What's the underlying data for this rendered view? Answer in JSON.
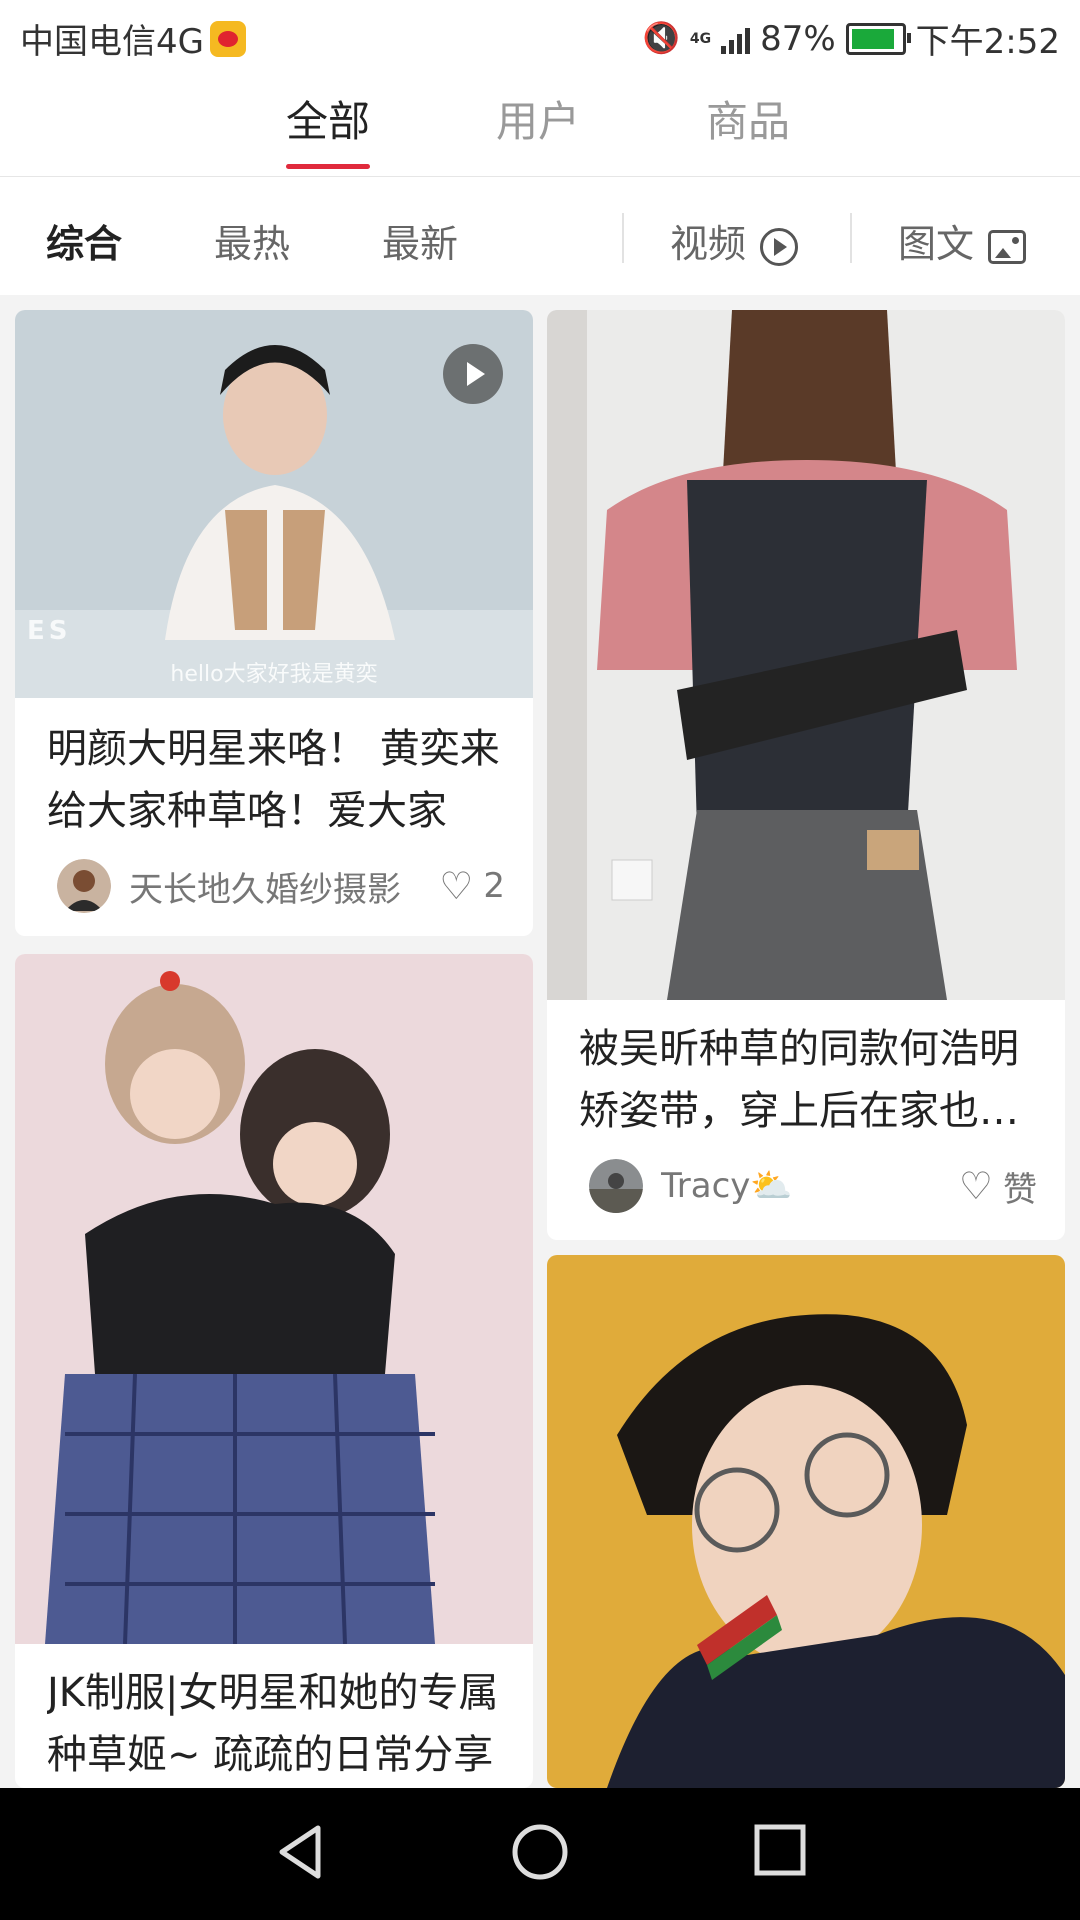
{
  "status_bar": {
    "carrier": "中国电信4G",
    "network": "4G",
    "battery": "87%",
    "time": "下午2:52"
  },
  "top_tabs": [
    {
      "label": "全部",
      "active": true
    },
    {
      "label": "用户",
      "active": false
    },
    {
      "label": "商品",
      "active": false
    }
  ],
  "filters": {
    "sort": [
      "综合",
      "最热",
      "最新"
    ],
    "video_label": "视频",
    "image_label": "图文"
  },
  "feed": [
    {
      "title": "明颜大明星来咯！ 黄奕来给大家种草咯！爱大家",
      "author": "天长地久婚纱摄影",
      "likes": "2",
      "is_video": true,
      "overlay_caption": "hello大家好我是黄奕",
      "overlay_mark": "ES"
    },
    {
      "title": "被吴昕种草的同款何浩明矫姿带，穿上后在家也能挺直",
      "author": "Tracy⛅",
      "likes": "赞",
      "is_video": false
    },
    {
      "title": "JK制服|女明星和她的专属种草姬~ 疏疏的日常分享",
      "author": "",
      "likes": "",
      "is_video": false
    },
    {
      "title": "",
      "author": "",
      "likes": "",
      "is_video": false
    }
  ],
  "colors": {
    "accent": "#e02a3c",
    "background": "#f3f3f3"
  },
  "icons": [
    "mute-icon",
    "signal-icon",
    "battery-icon",
    "play-icon",
    "image-icon",
    "heart-icon",
    "back-icon",
    "home-icon",
    "recent-apps-icon"
  ]
}
